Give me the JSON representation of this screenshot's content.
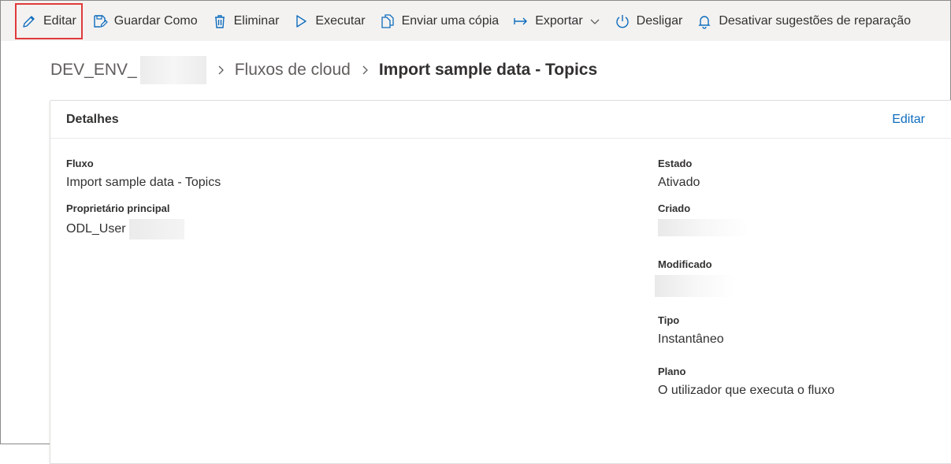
{
  "toolbar": {
    "edit": "Editar",
    "save_as": "Guardar Como",
    "delete": "Eliminar",
    "run": "Executar",
    "send_copy": "Enviar uma cópia",
    "export": "Exportar",
    "turn_off": "Desligar",
    "disable_suggestions": "Desativar sugestões de reparação",
    "icons": [
      "pencil-icon",
      "save-as-icon",
      "trash-icon",
      "play-icon",
      "copy-icon",
      "export-arrow-icon",
      "chevron-down-icon",
      "power-icon",
      "bell-icon"
    ]
  },
  "breadcrumb": {
    "env": "DEV_ENV_",
    "flows": "Fluxos de cloud",
    "current": "Import sample data - Topics"
  },
  "details": {
    "title": "Detalhes",
    "edit_link": "Editar",
    "flow_label": "Fluxo",
    "flow_value": "Import sample data - Topics",
    "owner_label": "Proprietário principal",
    "owner_value": "ODL_User",
    "state_label": "Estado",
    "state_value": "Ativado",
    "created_label": "Criado",
    "modified_label": "Modificado",
    "type_label": "Tipo",
    "type_value": "Instantâneo",
    "plan_label": "Plano",
    "plan_value": "O utilizador que executa o fluxo"
  },
  "colors": {
    "accent": "#0f6cbd",
    "highlight_border": "#e03a3a",
    "toolbar_bg": "#f3f2f1"
  }
}
